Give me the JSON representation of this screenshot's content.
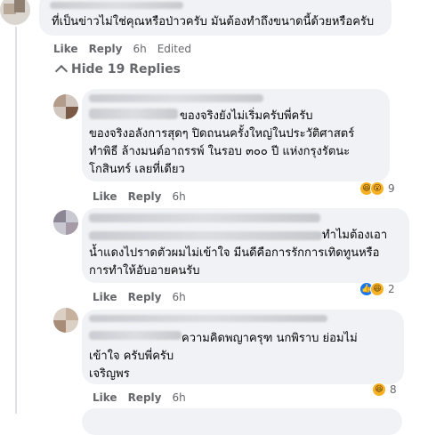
{
  "top_comment": {
    "text": "ที่เป็นข่าวไม่ใช่คุณหรือป่าวครับ มันต้องทำถึงขนาดนี้ด้วยหรือครับ",
    "like_label": "Like",
    "reply_label": "Reply",
    "time": "6h",
    "edited_label": "Edited"
  },
  "hide_replies_label": "Hide 19 Replies",
  "replies": [
    {
      "line1_tail": "ของจริงยังไม่เริ่มครับพี่ครับ",
      "line2": "ของจริงอลังการสุดๆ ปิดถนนครั้งใหญ่ในประวัติศาสตร์",
      "line3": "ทำพิธี ล้างมนต์อาถรรพ์ ในรอบ ๓๐๐ ปี แห่งกรุงรัตนะ",
      "line4": "โกสินทร์ เลยที่เดียว",
      "like_label": "Like",
      "reply_label": "Reply",
      "time": "6h",
      "reaction_count": "9",
      "reactions": [
        "haha-icon",
        "wow-icon"
      ]
    },
    {
      "line1_tail": "ทำไมต้องเอา",
      "line2": "น้ำแดงไปราดตัวผมไม่เข้าใจ มีนดีคือการรักการเทิดทูนหรือ",
      "line3": "การทำให้อับอายคนรับ",
      "like_label": "Like",
      "reply_label": "Reply",
      "time": "6h",
      "reaction_count": "2",
      "reactions": [
        "like-icon",
        "haha-icon"
      ]
    },
    {
      "line1_tail": "ความคิดพญาครุฑ นกพิราบ ย่อมไม่",
      "line2": "เข้าใจ ครับพี่ครับ",
      "line3": "เจริญพร",
      "like_label": "Like",
      "reply_label": "Reply",
      "time": "6h",
      "reaction_count": "8",
      "reactions": [
        "haha-icon"
      ]
    }
  ],
  "colors": {
    "bubble": "#f0f2f5",
    "meta": "#65676b",
    "like_blue": "#1877f2",
    "emoji_yellow": "#f7b125"
  }
}
